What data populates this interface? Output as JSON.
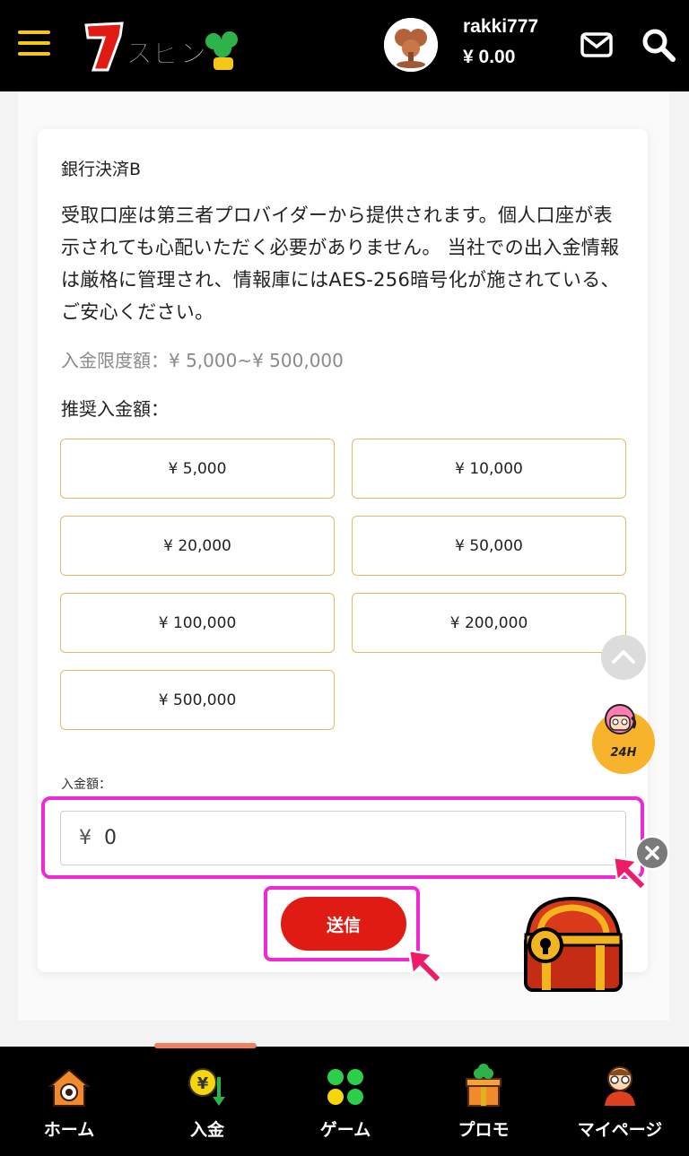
{
  "header": {
    "brand": "7スピン",
    "username": "rakki777",
    "balance": "¥ 0.00"
  },
  "payment": {
    "title": "銀行決済B",
    "notice": "受取口座は第三者プロバイダーから提供されます。個人口座が表示されても心配いただく必要がありません。 当社での出入金情報は厳格に管理され、情報庫にはAES-256暗号化が施されている、ご安心ください。",
    "limit": "入金限度額：¥ 5,000~¥ 500,000",
    "recommended_label": "推奨入金額：",
    "amounts": [
      "¥ 5,000",
      "¥ 10,000",
      "¥ 20,000",
      "¥ 50,000",
      "¥ 100,000",
      "¥ 200,000",
      "¥ 500,000"
    ],
    "field_label": "入金額：",
    "currency_symbol": "¥",
    "amount_value": "0",
    "submit_label": "送信"
  },
  "widgets": {
    "support_label": "24H"
  },
  "nav": {
    "items": [
      {
        "label": "ホーム",
        "icon": "home-icon"
      },
      {
        "label": "入金",
        "icon": "deposit-icon"
      },
      {
        "label": "ゲーム",
        "icon": "games-icon"
      },
      {
        "label": "プロモ",
        "icon": "promo-gift-icon"
      },
      {
        "label": "マイページ",
        "icon": "mypage-avatar-icon"
      }
    ],
    "active_index": 1
  },
  "colors": {
    "accent": "#f5c518",
    "submit": "#e01b14",
    "highlight": "#ee2ad3",
    "button_border": "#e5b96a"
  }
}
